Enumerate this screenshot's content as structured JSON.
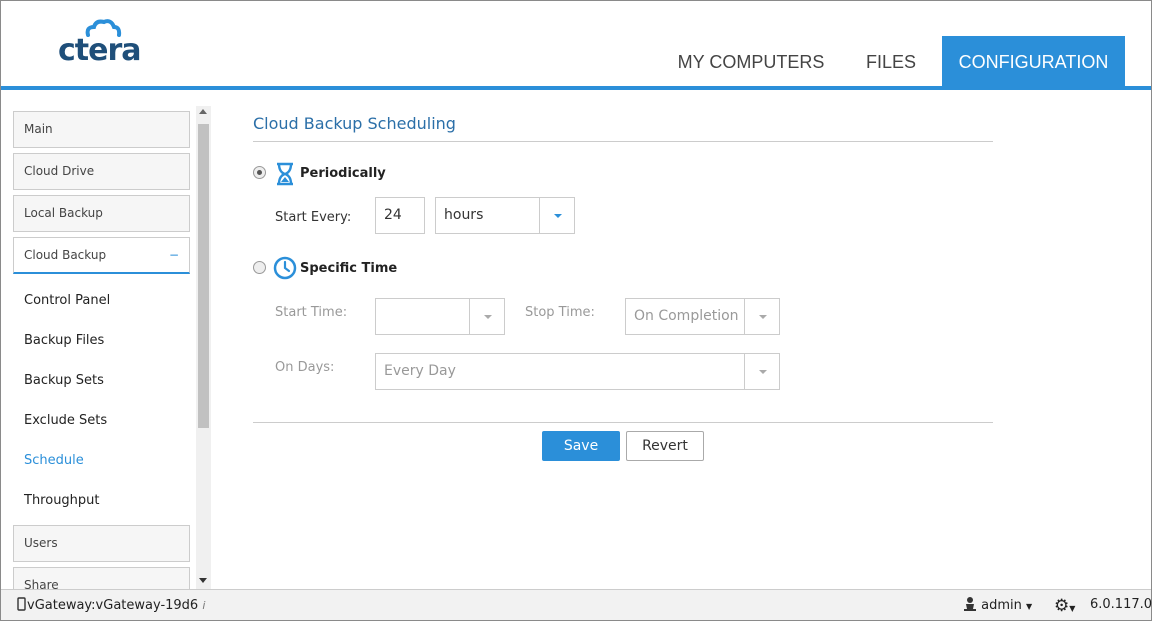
{
  "app": {
    "logo": "ctera",
    "brand_color": "#2b8fd9"
  },
  "nav": {
    "tabs": [
      {
        "label": "MY COMPUTERS"
      },
      {
        "label": "FILES"
      },
      {
        "label": "CONFIGURATION",
        "active": true
      }
    ]
  },
  "sidebar": {
    "items": [
      {
        "label": "Main"
      },
      {
        "label": "Cloud Drive"
      },
      {
        "label": "Local Backup"
      },
      {
        "label": "Cloud Backup",
        "expanded": true,
        "toggle": "−"
      }
    ],
    "subitems": [
      {
        "label": "Control Panel"
      },
      {
        "label": "Backup Files"
      },
      {
        "label": "Backup Sets"
      },
      {
        "label": "Exclude Sets"
      },
      {
        "label": "Schedule",
        "active": true
      },
      {
        "label": "Throughput"
      }
    ],
    "after_items": [
      {
        "label": "Users"
      },
      {
        "label": "Share"
      }
    ]
  },
  "main": {
    "title": "Cloud Backup Scheduling",
    "periodically": {
      "label": "Periodically",
      "icon": "hourglass-icon",
      "selected": true,
      "start_every_label": "Start Every:",
      "start_every_value": "24",
      "unit_value": "hours"
    },
    "specific_time": {
      "label": "Specific Time",
      "icon": "clock-icon",
      "selected": false,
      "start_time_label": "Start Time:",
      "start_time_value": "",
      "stop_time_label": "Stop Time:",
      "stop_time_value": "On Completion",
      "on_days_label": "On Days:",
      "on_days_value": "Every Day"
    },
    "save_label": "Save",
    "revert_label": "Revert"
  },
  "footer": {
    "device": "vGateway:vGateway-19d6",
    "user": "admin",
    "version": "6.0.117.0"
  }
}
